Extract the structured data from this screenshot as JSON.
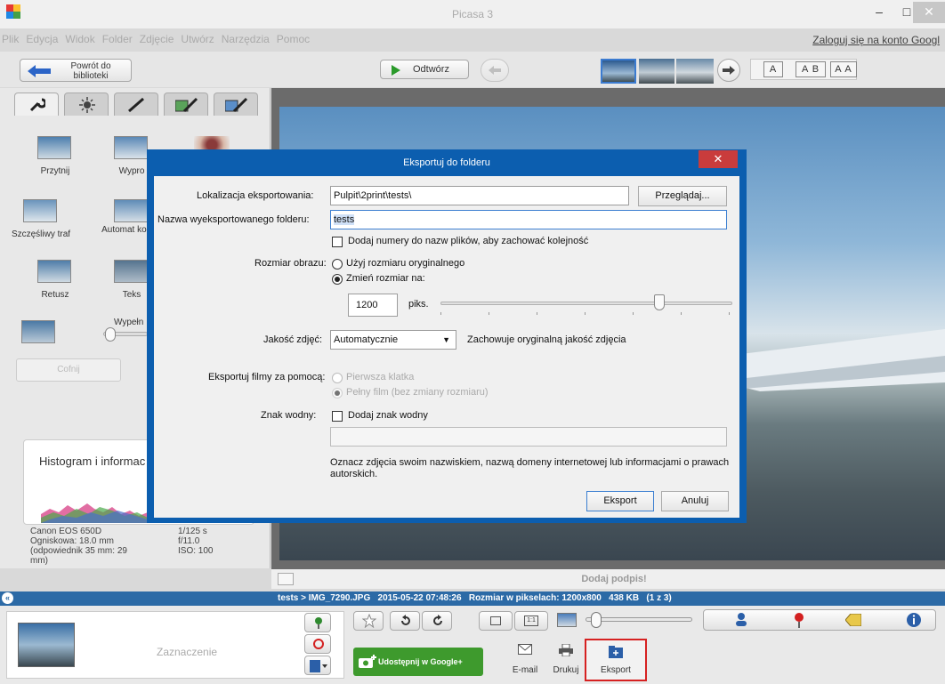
{
  "app": {
    "title": "Picasa 3",
    "login_link": "Zaloguj się na konto Googl"
  },
  "menu": [
    "Plik",
    "Edycja",
    "Widok",
    "Folder",
    "Zdjęcie",
    "Utwórz",
    "Narzędzia",
    "Pomoc"
  ],
  "toolbar": {
    "back_label": "Powrót do biblioteki",
    "play_label": "Odtwórz",
    "caption_modes": [
      "A",
      "A B",
      "A A"
    ]
  },
  "tools": {
    "items": [
      "Przytnij",
      "Wypro",
      "Szczęśliwy traf",
      "Automat kontra",
      "Retusz",
      "Teks"
    ],
    "fill_label": "Wypełn",
    "undo_label": "Cofnij"
  },
  "histogram": {
    "title": "Histogram i informac",
    "exif_left": [
      "Canon EOS 650D",
      "Ogniskowa: 18.0 mm",
      "(odpowiednik 35 mm: 29",
      "mm)"
    ],
    "exif_right": [
      "1/125 s",
      "f/11.0",
      "ISO: 100"
    ]
  },
  "photo": {
    "caption_placeholder": "Dodaj podpis!"
  },
  "status": {
    "text": "tests > IMG_7290.JPG   2015-05-22 07:48:26   Rozmiar w pikselach: 1200x800   438 KB   (1 z 3)"
  },
  "tray": {
    "selection_label": "Zaznaczenie",
    "share_label": "Udostępnij w Google+",
    "actions": [
      "E-mail",
      "Drukuj",
      "Eksport"
    ]
  },
  "dialog": {
    "title": "Eksportuj do folderu",
    "location_label": "Lokalizacja eksportowania:",
    "location_value": "Pulpit\\2print\\tests\\",
    "browse_label": "Przeglądaj...",
    "folder_label": "Nazwa wyeksportowanego folderu:",
    "folder_value": "tests",
    "numbers_label": "Dodaj numery do nazw plików, aby zachować kolejność",
    "size_label": "Rozmiar obrazu:",
    "size_original": "Użyj rozmiaru oryginalnego",
    "size_resize": "Zmień rozmiar na:",
    "size_value": "1200",
    "size_unit": "piks.",
    "size_slider_fraction": 0.75,
    "quality_label": "Jakość zdjęć:",
    "quality_value": "Automatycznie",
    "quality_note": "Zachowuje oryginalną jakość zdjęcia",
    "movies_label": "Eksportuj filmy za pomocą:",
    "movies_first": "Pierwsza klatka",
    "movies_full": "Pełny film (bez zmiany rozmiaru)",
    "watermark_label": "Znak wodny:",
    "watermark_check": "Dodaj znak wodny",
    "watermark_note": "Oznacz zdjęcia swoim nazwiskiem, nazwą domeny internetowej lub informacjami o prawach autorskich.",
    "export_label": "Eksport",
    "cancel_label": "Anuluj"
  }
}
